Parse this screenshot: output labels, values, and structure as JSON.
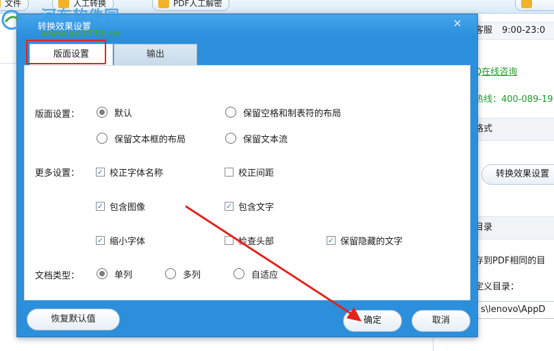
{
  "background_app": {
    "toolbar_buttons": [
      "文件",
      "人工转换",
      "PDF人工解密"
    ],
    "right_panel": {
      "service_label": "客服",
      "service_hours": "9:00-23:0",
      "qq_link": "Q在线咨询",
      "hotline": "热线：400-089-19",
      "format_section": "格式",
      "effect_button": "转换效果设置",
      "output_section": "目录",
      "same_dir_option": "存到PDF相同的目",
      "custom_dir_label": "定义目录：",
      "path_value": "s\\lenovo\\AppD"
    }
  },
  "watermark": {
    "site_name": "河东软件园",
    "site_url": "www.pc0359.cn"
  },
  "dialog": {
    "title": "转换效果设置",
    "close_glyph": "×",
    "tabs": [
      {
        "label": "版面设置",
        "active": true
      },
      {
        "label": "输出",
        "active": false
      }
    ],
    "layout_setting": {
      "label": "版面设置：",
      "options": [
        {
          "label": "默认",
          "selected": true
        },
        {
          "label": "保留空格和制表符的布局",
          "selected": false
        },
        {
          "label": "保留文本框的布局",
          "selected": false
        },
        {
          "label": "保留文本流",
          "selected": false
        }
      ]
    },
    "more_settings": {
      "label": "更多设置：",
      "options": [
        {
          "label": "校正字体名称",
          "checked": true
        },
        {
          "label": "校正间距",
          "checked": false
        },
        {
          "label": "包含图像",
          "checked": true
        },
        {
          "label": "包含文字",
          "checked": true
        },
        {
          "label": "缩小字体",
          "checked": true
        },
        {
          "label": "检查头部",
          "checked": false
        },
        {
          "label": "保留隐藏的文字",
          "checked": true
        }
      ]
    },
    "doc_type": {
      "label": "文档类型：",
      "options": [
        {
          "label": "单列",
          "selected": true
        },
        {
          "label": "多列",
          "selected": false
        },
        {
          "label": "自适应",
          "selected": false
        }
      ]
    },
    "buttons": {
      "restore_default": "恢复默认值",
      "ok": "确定",
      "cancel": "取消"
    }
  },
  "colors": {
    "dialog_blue": "#2b8fdc",
    "highlight_red": "#e2231a",
    "link_green": "#1f9a2a"
  }
}
